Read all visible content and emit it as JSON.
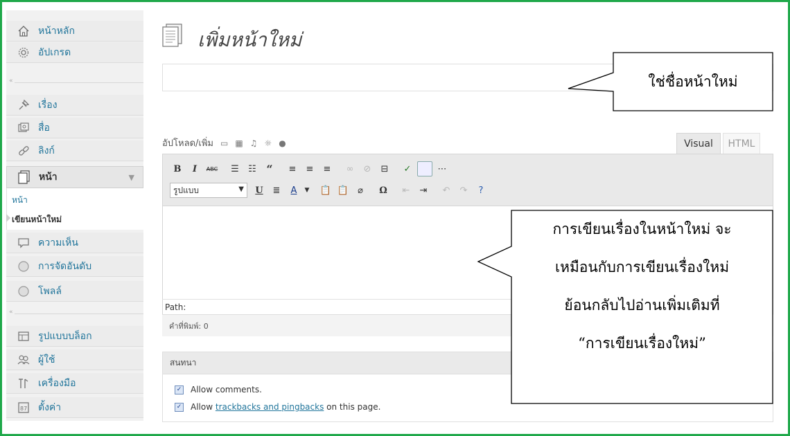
{
  "sidebar": {
    "top_items": [
      {
        "label": "หน้าหลัก",
        "icon": "home-icon"
      },
      {
        "label": "อัปเกรด",
        "icon": "gear-icon"
      }
    ],
    "content_items": [
      {
        "label": "เรื่อง",
        "icon": "pin-icon"
      },
      {
        "label": "สื่อ",
        "icon": "media-icon"
      },
      {
        "label": "ลิงก์",
        "icon": "link-icon"
      }
    ],
    "active_item": {
      "label": "หน้า",
      "icon": "page-icon"
    },
    "submenu": {
      "pages": "หน้า",
      "new_page": "เขียนหน้าใหม่"
    },
    "after_items": [
      {
        "label": "ความเห็น",
        "icon": "comment-icon"
      },
      {
        "label": "การจัดอันดับ",
        "icon": "rating-icon"
      },
      {
        "label": "โพลล์",
        "icon": "poll-icon"
      }
    ],
    "bottom_items": [
      {
        "label": "รูปแบบบล็อก",
        "icon": "appearance-icon"
      },
      {
        "label": "ผู้ใช้",
        "icon": "users-icon"
      },
      {
        "label": "เครื่องมือ",
        "icon": "tools-icon"
      },
      {
        "label": "ตั้งค่า",
        "icon": "settings-icon"
      }
    ]
  },
  "header": {
    "title": "เพิ่มหน้าใหม่"
  },
  "editor": {
    "upload_label": "อัปโหลด/เพิ่ม",
    "tabs": {
      "visual": "Visual",
      "html": "HTML"
    },
    "format_select": "รูปแบบ",
    "path_label": "Path:",
    "word_count": "คำที่พิมพ์: 0"
  },
  "discussion": {
    "title": "สนทนา",
    "allow_comments": "Allow comments.",
    "allow_prefix": "Allow",
    "trackbacks_link": "trackbacks and pingbacks",
    "allow_suffix": "on this page."
  },
  "callouts": {
    "title_hint": "ใช่ชื่อหน้าใหม่",
    "lines": [
      "การเขียนเรื่องในหน้าใหม่ จะ",
      "เหมือนกับการเขียนเรื่องใหม่",
      "ย้อนกลับไปอ่านเพิ่มเติมที่",
      "“การเขียนเรื่องใหม่”"
    ]
  }
}
